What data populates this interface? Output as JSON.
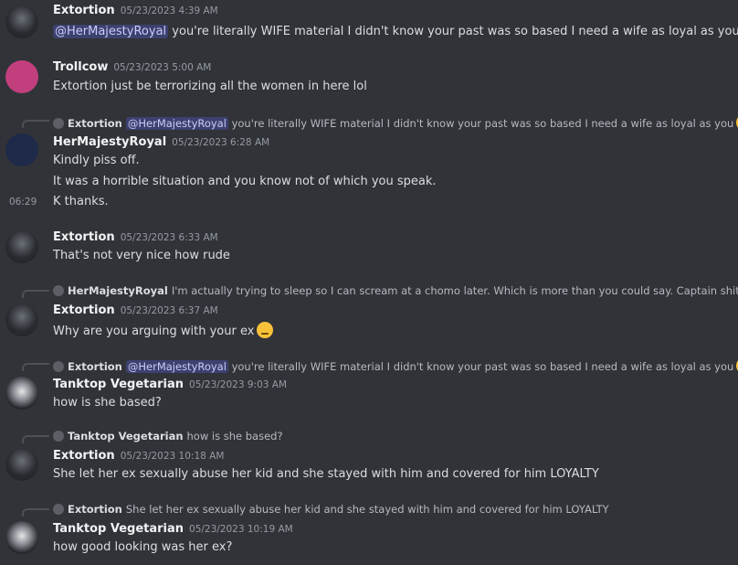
{
  "messages": {
    "m1": {
      "author": "Extortion",
      "time": "05/23/2023 4:39 AM",
      "mention": "@HerMajestyRoyal",
      "text": "you're literally WIFE material I didn't know your past was so based I need a wife as loyal as you"
    },
    "m2": {
      "author": "Trollcow",
      "time": "05/23/2023 5:00 AM",
      "text": "Extortion just be terrorizing all the women in here lol"
    },
    "m3": {
      "reply": {
        "author": "Extortion",
        "mention": "@HerMajestyRoyal",
        "text": "you're literally WIFE material I didn't know your past was so based I need a wife as loyal as you"
      },
      "author": "HerMajestyRoyal",
      "time": "05/23/2023 6:28 AM",
      "text": "Kindly piss off.",
      "text2": "It was a horrible situation and you know not of which you speak.",
      "side_time": "06:29",
      "text3": "K thanks."
    },
    "m4": {
      "author": "Extortion",
      "time": "05/23/2023 6:33 AM",
      "text": "That's not very nice how rude"
    },
    "m5": {
      "reply": {
        "author": "HerMajestyRoyal",
        "text": "I'm actually trying to sleep so I can scream at a chomo later. Which is more than you could say. Captain shitpost"
      },
      "author": "Extortion",
      "time": "05/23/2023 6:37 AM",
      "text": "Why are you arguing with your ex"
    },
    "m6": {
      "reply": {
        "author": "Extortion",
        "mention": "@HerMajestyRoyal",
        "text": "you're literally WIFE material I didn't know your past was so based I need a wife as loyal as you"
      },
      "author": "Tanktop Vegetarian",
      "time": "05/23/2023 9:03 AM",
      "text": "how is she based?"
    },
    "m7": {
      "reply": {
        "author": "Tanktop Vegetarian",
        "text": "how is she based?"
      },
      "author": "Extortion",
      "time": "05/23/2023 10:18 AM",
      "text": "She let her ex sexually abuse her kid and she stayed with him and covered for him LOYALTY"
    },
    "m8": {
      "reply": {
        "author": "Extortion",
        "text": "She let her ex sexually abuse her kid and she stayed with him and covered for him LOYALTY"
      },
      "author": "Tanktop Vegetarian",
      "time": "05/23/2023 10:19 AM",
      "text": "how good looking was her ex?"
    }
  },
  "icons": {
    "avatar_extortion": "dark-skull-avatar",
    "avatar_trollcow": "pink-cartoon-avatar",
    "avatar_royal": "blue-hair-avatar",
    "avatar_tanktop": "anime-cap-avatar",
    "emoji_kiss": "face-blowing-kiss",
    "emoji_relieved": "relieved-face"
  },
  "colors": {
    "background": "#313338",
    "mention_bg": "#3c4270",
    "text": "#dbdee1",
    "timestamp": "#949ba4"
  }
}
